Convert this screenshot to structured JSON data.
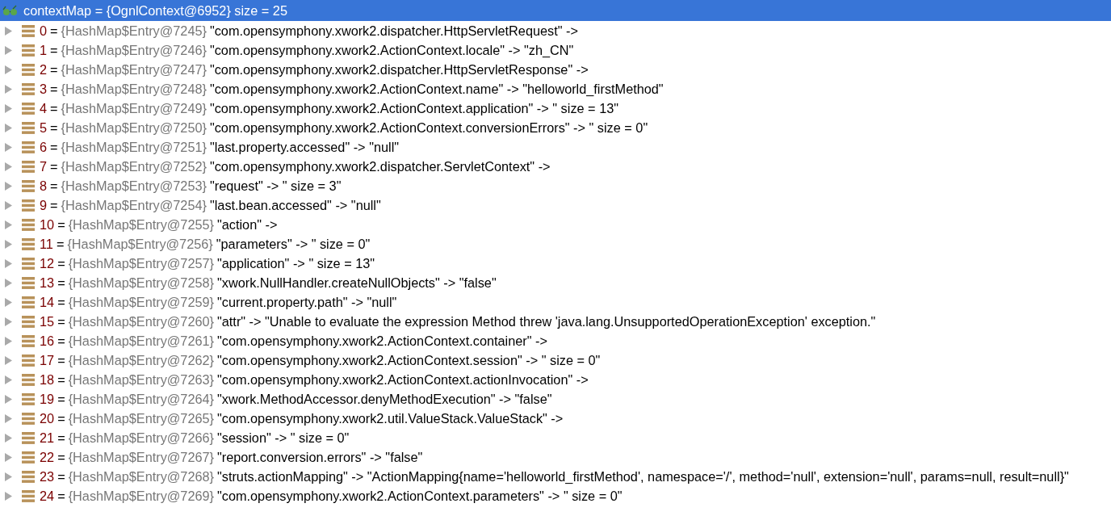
{
  "root": {
    "label": "contextMap = {OgnlContext@6952}  size = 25",
    "selected": true
  },
  "rows": [
    {
      "index": "0",
      "equals": "=",
      "ref": "{HashMap$Entry@7245}",
      "value": "\"com.opensymphony.xwork2.dispatcher.HttpServletRequest\" ->",
      "selected": false
    },
    {
      "index": "1",
      "equals": "=",
      "ref": "{HashMap$Entry@7246}",
      "value": "\"com.opensymphony.xwork2.ActionContext.locale\" -> \"zh_CN\"",
      "selected": false
    },
    {
      "index": "2",
      "equals": "=",
      "ref": "{HashMap$Entry@7247}",
      "value": "\"com.opensymphony.xwork2.dispatcher.HttpServletResponse\" ->",
      "selected": false
    },
    {
      "index": "3",
      "equals": "=",
      "ref": "{HashMap$Entry@7248}",
      "value": "\"com.opensymphony.xwork2.ActionContext.name\" -> \"helloworld_firstMethod\"",
      "selected": false
    },
    {
      "index": "4",
      "equals": "=",
      "ref": "{HashMap$Entry@7249}",
      "value": "\"com.opensymphony.xwork2.ActionContext.application\" -> \" size = 13\"",
      "selected": false
    },
    {
      "index": "5",
      "equals": "=",
      "ref": "{HashMap$Entry@7250}",
      "value": "\"com.opensymphony.xwork2.ActionContext.conversionErrors\" -> \" size = 0\"",
      "selected": false
    },
    {
      "index": "6",
      "equals": "=",
      "ref": "{HashMap$Entry@7251}",
      "value": "\"last.property.accessed\" -> \"null\"",
      "selected": false
    },
    {
      "index": "7",
      "equals": "=",
      "ref": "{HashMap$Entry@7252}",
      "value": "\"com.opensymphony.xwork2.dispatcher.ServletContext\" ->",
      "selected": false
    },
    {
      "index": "8",
      "equals": "=",
      "ref": "{HashMap$Entry@7253}",
      "value": "\"request\" -> \" size = 3\"",
      "selected": false
    },
    {
      "index": "9",
      "equals": "=",
      "ref": "{HashMap$Entry@7254}",
      "value": "\"last.bean.accessed\" -> \"null\"",
      "selected": false
    },
    {
      "index": "10",
      "equals": "=",
      "ref": "{HashMap$Entry@7255}",
      "value": "\"action\" ->",
      "selected": false
    },
    {
      "index": "11",
      "equals": "=",
      "ref": "{HashMap$Entry@7256}",
      "value": "\"parameters\" -> \" size = 0\"",
      "selected": false
    },
    {
      "index": "12",
      "equals": "=",
      "ref": "{HashMap$Entry@7257}",
      "value": "\"application\" -> \" size = 13\"",
      "selected": false
    },
    {
      "index": "13",
      "equals": "=",
      "ref": "{HashMap$Entry@7258}",
      "value": "\"xwork.NullHandler.createNullObjects\" -> \"false\"",
      "selected": false
    },
    {
      "index": "14",
      "equals": "=",
      "ref": "{HashMap$Entry@7259}",
      "value": "\"current.property.path\" -> \"null\"",
      "selected": false
    },
    {
      "index": "15",
      "equals": "=",
      "ref": "{HashMap$Entry@7260}",
      "value": "\"attr\" -> \"Unable to evaluate the expression Method threw 'java.lang.UnsupportedOperationException' exception.\"",
      "selected": false
    },
    {
      "index": "16",
      "equals": "=",
      "ref": "{HashMap$Entry@7261}",
      "value": "\"com.opensymphony.xwork2.ActionContext.container\" ->",
      "selected": false
    },
    {
      "index": "17",
      "equals": "=",
      "ref": "{HashMap$Entry@7262}",
      "value": "\"com.opensymphony.xwork2.ActionContext.session\" -> \" size = 0\"",
      "selected": false
    },
    {
      "index": "18",
      "equals": "=",
      "ref": "{HashMap$Entry@7263}",
      "value": "\"com.opensymphony.xwork2.ActionContext.actionInvocation\" ->",
      "selected": false
    },
    {
      "index": "19",
      "equals": "=",
      "ref": "{HashMap$Entry@7264}",
      "value": "\"xwork.MethodAccessor.denyMethodExecution\" -> \"false\"",
      "selected": false
    },
    {
      "index": "20",
      "equals": "=",
      "ref": "{HashMap$Entry@7265}",
      "value": "\"com.opensymphony.xwork2.util.ValueStack.ValueStack\" ->",
      "selected": false
    },
    {
      "index": "21",
      "equals": "=",
      "ref": "{HashMap$Entry@7266}",
      "value": "\"session\" -> \" size = 0\"",
      "selected": false
    },
    {
      "index": "22",
      "equals": "=",
      "ref": "{HashMap$Entry@7267}",
      "value": "\"report.conversion.errors\" -> \"false\"",
      "selected": false
    },
    {
      "index": "23",
      "equals": "=",
      "ref": "{HashMap$Entry@7268}",
      "value": "\"struts.actionMapping\" -> \"ActionMapping{name='helloworld_firstMethod', namespace='/', method='null', extension='null', params=null, result=null}\"",
      "selected": false
    },
    {
      "index": "24",
      "equals": "=",
      "ref": "{HashMap$Entry@7269}",
      "value": "\"com.opensymphony.xwork2.ActionContext.parameters\" -> \" size = 0\"",
      "selected": false
    }
  ]
}
